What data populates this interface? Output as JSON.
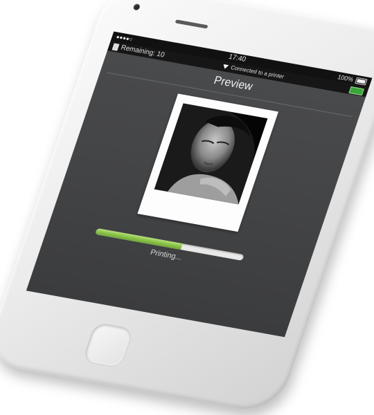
{
  "status_bar": {
    "signal": "●●●●○ ",
    "time": "17:40",
    "battery_percent": "100%"
  },
  "info_bar": {
    "remaining": "Remaining: 10",
    "connection_status": "Connected to a printer",
    "printer_battery_color": "#3aa53a"
  },
  "screen": {
    "title": "Preview",
    "photo_description_icon": "portrait-photo",
    "progress_fraction": 0.58,
    "progress_color": "#8cc34a",
    "progress_label": "Printing..."
  }
}
